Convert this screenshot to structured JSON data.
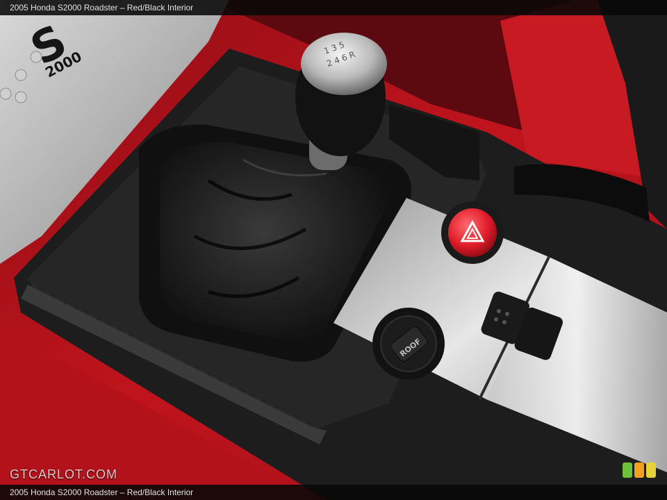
{
  "caption": {
    "top": "2005 Honda S2000 Roadster – Red/Black Interior",
    "bottom": "2005 Honda S2000 Roadster – Red/Black Interior"
  },
  "photo": {
    "plate_logo_text": "S2000",
    "roof_button_text": "ROOF",
    "shift_pattern": "1 3 5 / 2 4 6 R",
    "colors": {
      "leather_red": "#c0141d",
      "console_black": "#1b1b1b",
      "brushed_aluminum": "#b8b8b8",
      "hazard_red": "#e11d2a"
    }
  },
  "watermark": {
    "text": "GTCARLOT.COM",
    "logo_colors": [
      "#6fbf3a",
      "#f0a020",
      "#e6d23a"
    ]
  }
}
